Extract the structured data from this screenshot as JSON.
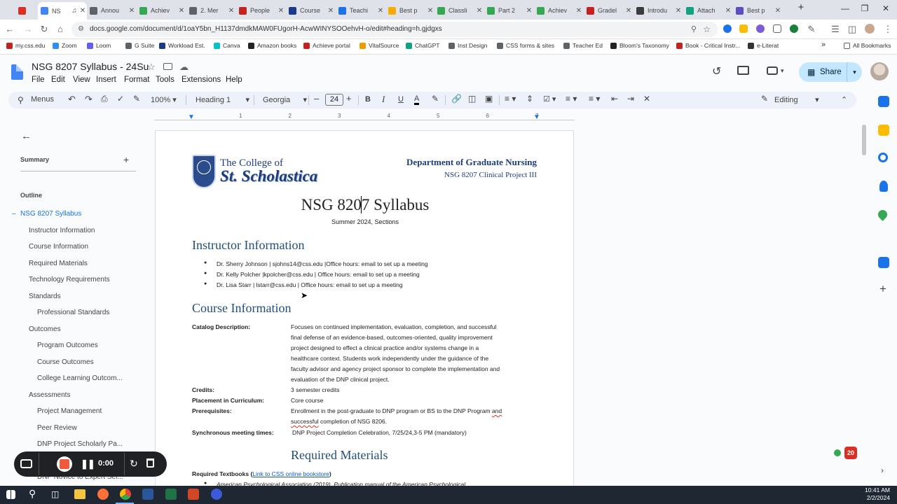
{
  "browser": {
    "tabs": [
      {
        "label": "",
        "icon": "record-icon",
        "color": "#d93025"
      },
      {
        "label": "NS",
        "icon": "docs-icon",
        "color": "#4285f4",
        "active": true
      },
      {
        "label": "Annou",
        "icon": "gear-icon",
        "color": "#5f6368"
      },
      {
        "label": "Achiev",
        "icon": "shield-icon",
        "color": "#34a853"
      },
      {
        "label": "2. Mer",
        "icon": "gear-icon",
        "color": "#5f6368"
      },
      {
        "label": "People",
        "icon": "achieve-icon",
        "color": "#c5221f"
      },
      {
        "label": "Course",
        "icon": "book-icon",
        "color": "#1a3a8a"
      },
      {
        "label": "Teachi",
        "icon": "board-icon",
        "color": "#1a73e8"
      },
      {
        "label": "Best p",
        "icon": "folder-icon",
        "color": "#f9ab00"
      },
      {
        "label": "Classli",
        "icon": "shield-icon",
        "color": "#34a853"
      },
      {
        "label": "Part 2",
        "icon": "shield-icon",
        "color": "#34a853"
      },
      {
        "label": "Achiev",
        "icon": "shield-icon",
        "color": "#34a853"
      },
      {
        "label": "Gradel",
        "icon": "achieve-icon",
        "color": "#c5221f"
      },
      {
        "label": "Introdu",
        "icon": "book-icon",
        "color": "#3c3c3c"
      },
      {
        "label": "Attach",
        "icon": "chatgpt-icon",
        "color": "#10a37f"
      },
      {
        "label": "Best p",
        "icon": "gear-icon",
        "color": "#5b4fbf"
      }
    ],
    "new_tab": "+",
    "url": "docs.google.com/document/d/1oaY5bn_H1137dmdkMAW0FUgorH-AcwWINYSOOehvH-o/edit#heading=h.gjdgxs",
    "bookmarks": [
      {
        "label": "my.css.edu",
        "color": "#c5221f"
      },
      {
        "label": "Zoom",
        "color": "#2d8cff"
      },
      {
        "label": "Loom",
        "color": "#625df5"
      },
      {
        "label": "G Suite",
        "color": "#5f6368"
      },
      {
        "label": "Workload Est.",
        "color": "#1a3a8a"
      },
      {
        "label": "Canva",
        "color": "#00c4cc"
      },
      {
        "label": "Amazon books",
        "color": "#222"
      },
      {
        "label": "Achieve portal",
        "color": "#c5221f"
      },
      {
        "label": "VitalSource",
        "color": "#f29900"
      },
      {
        "label": "ChatGPT",
        "color": "#10a37f"
      },
      {
        "label": "Inst Design",
        "color": "#5f6368"
      },
      {
        "label": "CSS forms & sites",
        "color": "#5f6368"
      },
      {
        "label": "Teacher Ed",
        "color": "#5f6368"
      },
      {
        "label": "Bloom's Taxonomy",
        "color": "#222"
      },
      {
        "label": "Book - Critical Instr...",
        "color": "#c5221f"
      },
      {
        "label": "e-Literat",
        "color": "#333"
      }
    ],
    "bookmarks_more": "»",
    "all_bookmarks": "All Bookmarks"
  },
  "docs": {
    "title": "NSG 8207 Syllabus - 24Su",
    "menu": [
      "File",
      "Edit",
      "View",
      "Insert",
      "Format",
      "Tools",
      "Extensions",
      "Help"
    ],
    "share_label": "Share",
    "toolbar": {
      "menus_label": "Menus",
      "zoom": "100%",
      "style": "Heading 1",
      "font": "Georgia",
      "font_size": "24",
      "mode": "Editing"
    },
    "ruler_marks": [
      "1",
      "2",
      "3",
      "4",
      "5",
      "6",
      "7"
    ]
  },
  "outline": {
    "summary_label": "Summary",
    "outline_label": "Outline",
    "items": [
      {
        "label": "NSG 8207 Syllabus",
        "level": 0,
        "active": true
      },
      {
        "label": "Instructor Information",
        "level": 1
      },
      {
        "label": "Course Information",
        "level": 1
      },
      {
        "label": "Required Materials",
        "level": 1
      },
      {
        "label": "Technology Requirements",
        "level": 1
      },
      {
        "label": "Standards",
        "level": 1
      },
      {
        "label": "Professional Standards",
        "level": 2
      },
      {
        "label": "Outcomes",
        "level": 1
      },
      {
        "label": "Program Outcomes",
        "level": 2
      },
      {
        "label": "Course Outcomes",
        "level": 2
      },
      {
        "label": "College Learning Outcom...",
        "level": 2
      },
      {
        "label": "Assessments",
        "level": 1
      },
      {
        "label": "Project Management",
        "level": 2
      },
      {
        "label": "Peer Review",
        "level": 2
      },
      {
        "label": "DNP Project Scholarly Pa...",
        "level": 2
      },
      {
        "label": "Dis...",
        "level": 2
      },
      {
        "label": "DNP Novice to Expert Sel...",
        "level": 2
      }
    ]
  },
  "document": {
    "logo_line1": "The College of",
    "logo_line2": "St. Scholastica",
    "dept": "Department of Graduate Nursing",
    "course_code": "NSG 8207 Clinical Project III",
    "title_before_cursor": "NSG 820",
    "title_after_cursor": "7 Syllabus",
    "subtitle": "Summer 2024, Sections",
    "instructor_heading": "Instructor Information",
    "instructors": [
      "Dr. Sherry Johnson | sjohns14@css.edu |Office hours: email to set up a meeting",
      "Dr. Kelly Polcher |kpolcher@css.edu | Office hours: email to set up a meeting",
      "Dr. Lisa Starr | lstarr@css.edu | Office hours: email to set up a meeting"
    ],
    "course_heading": "Course Information",
    "catalog_label": "Catalog Description:",
    "catalog_lines": [
      "Focuses on continued implementation, evaluation, completion, and successful",
      "final defense of an evidence-based, outcomes-oriented, quality improvement",
      "project designed to effect a clinical practice and/or systems change in a",
      "healthcare context. Students work independently under the guidance of the",
      "faculty advisor and agency project sponsor to complete the implementation and",
      "evaluation of the DNP clinical project."
    ],
    "credits_label": "Credits:",
    "credits_value": "3 semester credits",
    "placement_label": "Placement in Curriculum:",
    "placement_value": "Core course",
    "prereq_label": "Prerequisites:",
    "prereq_line1_a": "Enrollment in the post-graduate to DNP program or BS to the DNP Program ",
    "prereq_line1_b": "and",
    "prereq_line2_a": "successful",
    "prereq_line2_b": " completion of NSG 8206.",
    "sync_label": "Synchronous meeting times:",
    "sync_value": "DNP Project Completion Celebration, 7/25/24,3-5 PM (mandatory)",
    "materials_heading": "Required Materials",
    "textbooks_label": "Required Textbooks",
    "textbooks_link": "Link to CSS online bookstore",
    "textbook_1": "American Psychological Association (2019). Publication manual of the American Psychological"
  },
  "recorder": {
    "time": "0:00"
  },
  "taskbar": {
    "time": "10:41 AM",
    "date": "2/2/2024"
  },
  "notification_badge": "20"
}
